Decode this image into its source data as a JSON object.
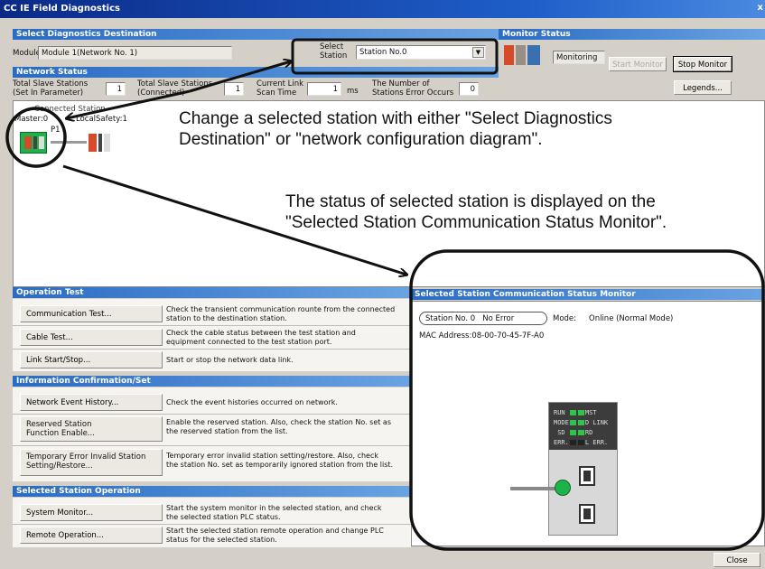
{
  "window": {
    "title": "CC IE Field Diagnostics",
    "close": "x"
  },
  "diag_dest": {
    "header": "Select Diagnostics Destination",
    "module_label": "Module",
    "module_value": "Module 1(Network No. 1)",
    "select_station_label_1": "Select",
    "select_station_label_2": "Station",
    "select_station_value": "Station No.0"
  },
  "monitor_status": {
    "header": "Monitor Status",
    "state": "Monitoring",
    "start_button": "Start Monitor",
    "stop_button": "Stop Monitor",
    "legends_button": "Legends..."
  },
  "network_status": {
    "header": "Network Status",
    "total_param_label_1": "Total Slave Stations",
    "total_param_label_2": "(Set In Parameter)",
    "total_param_value": "1",
    "total_conn_label_1": "Total Slave Stations",
    "total_conn_label_2": "(Connected)",
    "total_conn_value": "1",
    "scan_label_1": "Current Link",
    "scan_label_2": "Scan Time",
    "scan_value": "1",
    "scan_unit": "ms",
    "err_label_1": "The Number of",
    "err_label_2": "Stations Error Occurs",
    "err_value": "0"
  },
  "diagram": {
    "master_label": "Master:0",
    "port_label": "P1",
    "connected_label": "Connected Station",
    "local_label": "LocalSafety:1"
  },
  "callouts": {
    "c1_line1": "Change a selected station with either \"Select Diagnostics",
    "c1_line2": "Destination\" or \"network configuration diagram\".",
    "c2_line1": "The status of selected station is displayed on the",
    "c2_line2": "\"Selected Station Communication Status Monitor\"."
  },
  "operation_test": {
    "header": "Operation Test",
    "items": [
      {
        "label": "Communication Test...",
        "desc1": "Check the transient communication rounte from the connected",
        "desc2": "station to the destination station."
      },
      {
        "label": "Cable Test...",
        "desc1": "Check the cable status between the test station and",
        "desc2": "equipment connected to the test station port."
      },
      {
        "label": "Link Start/Stop...",
        "desc1": "Start or stop the network data link.",
        "desc2": ""
      }
    ]
  },
  "info_confirm": {
    "header": "Information Confirmation/Set",
    "items": [
      {
        "label1": "Network Event History...",
        "label2": "",
        "desc1": "Check the event histories occurred on network.",
        "desc2": ""
      },
      {
        "label1": "Reserved Station",
        "label2": "Function Enable...",
        "desc1": "Enable the reserved station. Also, check the station No. set as",
        "desc2": "the reserved station from the list."
      },
      {
        "label1": "Temporary Error Invalid Station",
        "label2": "Setting/Restore...",
        "desc1": "Temporary error invalid station setting/restore. Also, check",
        "desc2": "the station No. set as temporarily ignored station from the list."
      }
    ]
  },
  "station_op": {
    "header": "Selected Station Operation",
    "items": [
      {
        "label": "System Monitor...",
        "desc1": "Start the system monitor in the selected station, and check",
        "desc2": "the selected station PLC status."
      },
      {
        "label": "Remote Operation...",
        "desc1": "Start the selected station remote operation and change PLC",
        "desc2": "status for the selected station."
      }
    ]
  },
  "status_monitor": {
    "header": "Selected Station Communication Status Monitor",
    "station": "Station No. 0",
    "status": "No Error",
    "mode_label": "Mode:",
    "mode_value": "Online (Normal Mode)",
    "mac": "MAC Address:08-00-70-45-7F-A0",
    "leds": {
      "run": "RUN",
      "mst": "MST",
      "mode": "MODE",
      "dlink": "D LINK",
      "sd": "SD",
      "rd": "RD",
      "err": "ERR.",
      "lerr": "L ERR."
    }
  },
  "footer": {
    "close_button": "Close"
  },
  "colors": {
    "header_blue": "#2a6bc3",
    "led_green": "#2ec44a",
    "port_green": "#1fb14a"
  }
}
